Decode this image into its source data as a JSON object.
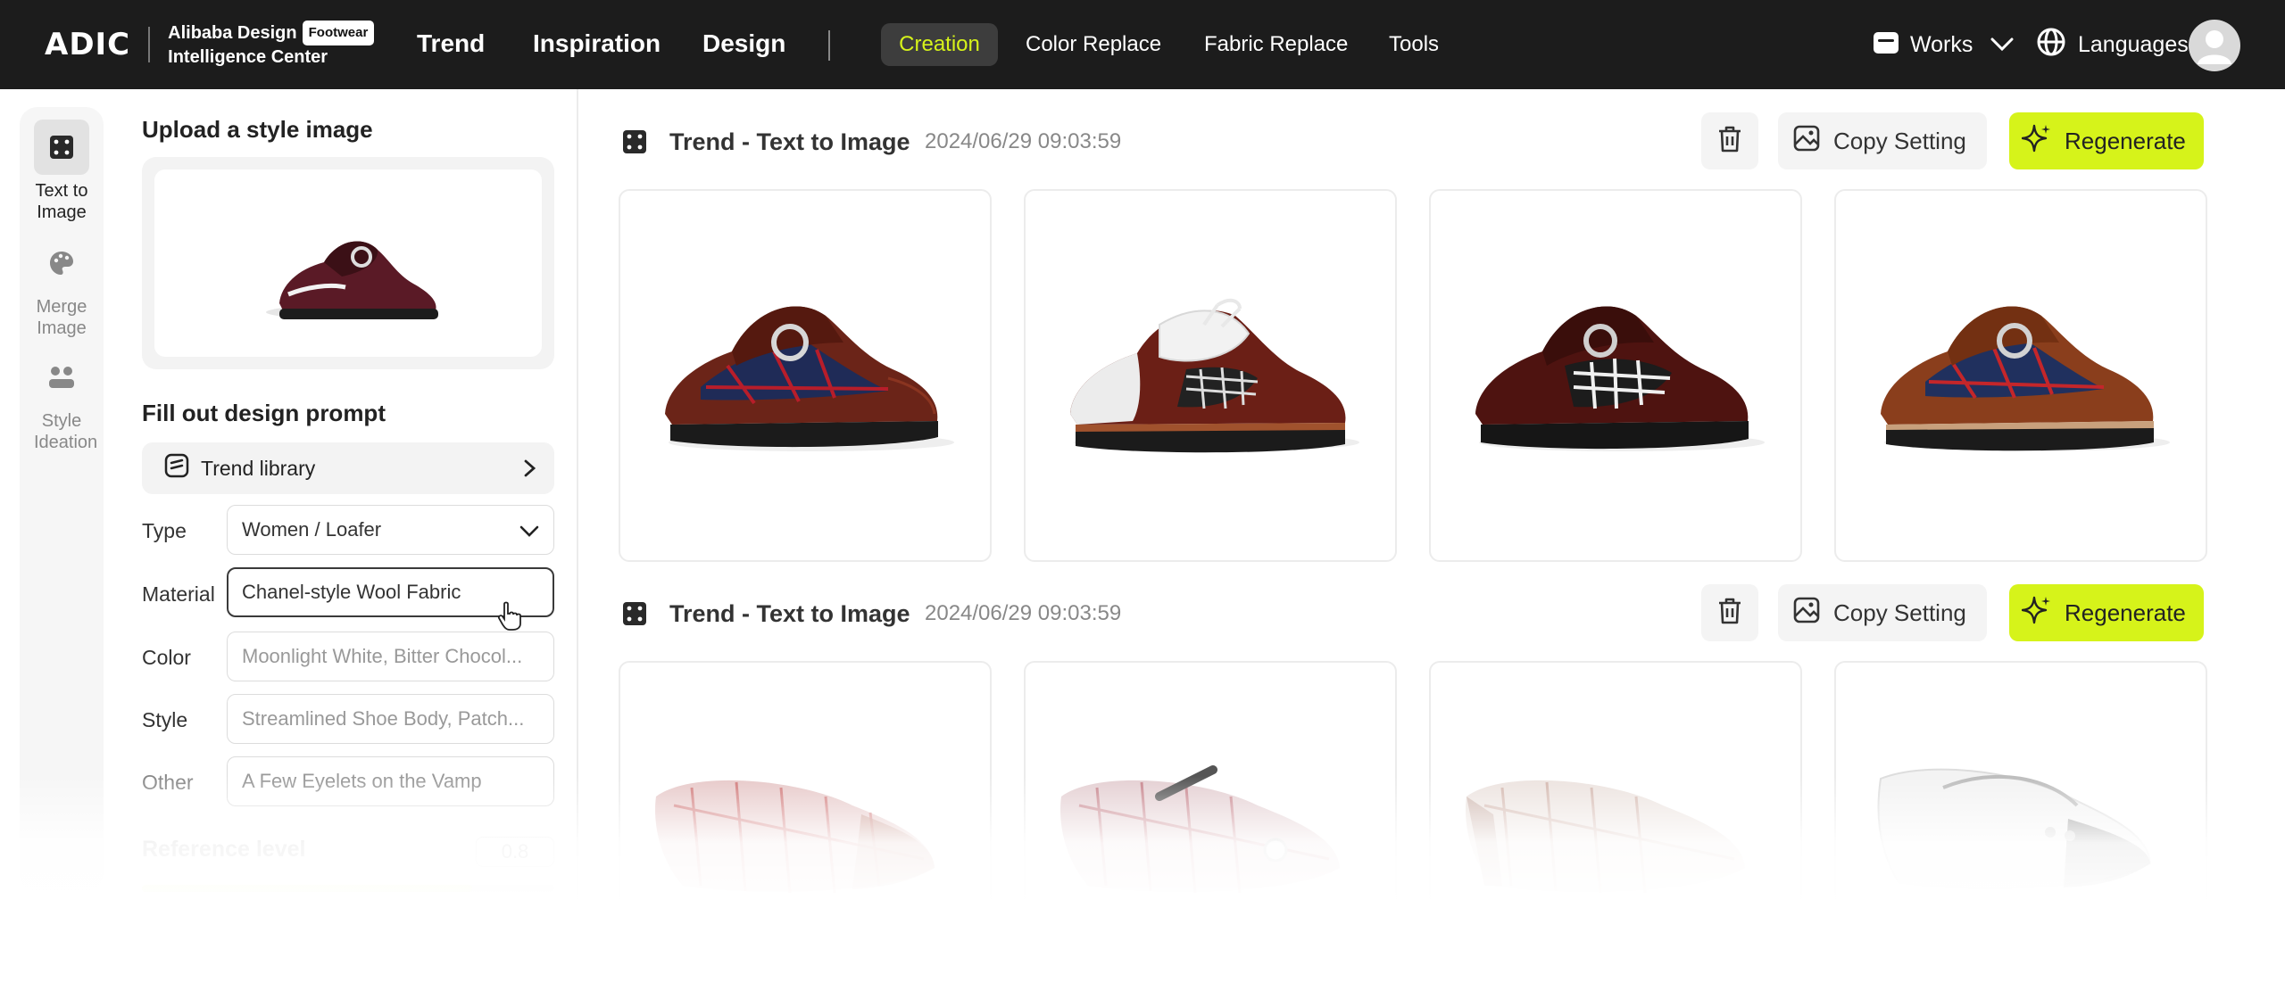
{
  "brand": {
    "logo": "ADIC",
    "name_line1": "Alibaba Design",
    "badge": "Footwear",
    "name_line2": "Intelligence Center"
  },
  "nav": {
    "main": [
      "Trend",
      "Inspiration",
      "Design"
    ],
    "sub": [
      "Creation",
      "Color Replace",
      "Fabric Replace",
      "Tools"
    ],
    "active_sub": "Creation",
    "works": "Works",
    "languages": "Languages"
  },
  "rail": [
    {
      "label": "Text to Image",
      "icon": "text-to-image-icon",
      "active": true
    },
    {
      "label": "Merge Image",
      "icon": "palette-icon",
      "active": false
    },
    {
      "label": "Style Ideation",
      "icon": "style-ideation-icon",
      "active": false
    }
  ],
  "form": {
    "upload_title": "Upload a style image",
    "prompt_title": "Fill out design prompt",
    "trend_library": "Trend library",
    "fields": {
      "type": {
        "label": "Type",
        "value": "Women / Loafer"
      },
      "material": {
        "label": "Material",
        "value": "Chanel-style Wool Fabric"
      },
      "color": {
        "label": "Color",
        "placeholder": "Moonlight White, Bitter Chocol..."
      },
      "style": {
        "label": "Style",
        "placeholder": "Streamlined Shoe Body, Patch..."
      },
      "other": {
        "label": "Other",
        "placeholder": "A Few Eyelets on the Vamp"
      }
    },
    "reference_level": {
      "label": "Reference level",
      "value": "0.8"
    }
  },
  "results": [
    {
      "title": "Trend - Text to Image",
      "timestamp": "2024/06/29 09:03:59",
      "copy_label": "Copy Setting",
      "regen_label": "Regenerate",
      "images": [
        "loafer-navy-plaid",
        "derby-white-plaid",
        "loafer-bw-check",
        "loafer-brown-plaid"
      ]
    },
    {
      "title": "Trend - Text to Image",
      "timestamp": "2024/06/29 09:03:59",
      "copy_label": "Copy Setting",
      "regen_label": "Regenerate",
      "images": [
        "pump-plaid",
        "maryjane-plaid",
        "pump-tweed",
        "pump-white"
      ]
    }
  ],
  "colors": {
    "accent": "#d6f31a",
    "topbar": "#1c1c1c"
  }
}
